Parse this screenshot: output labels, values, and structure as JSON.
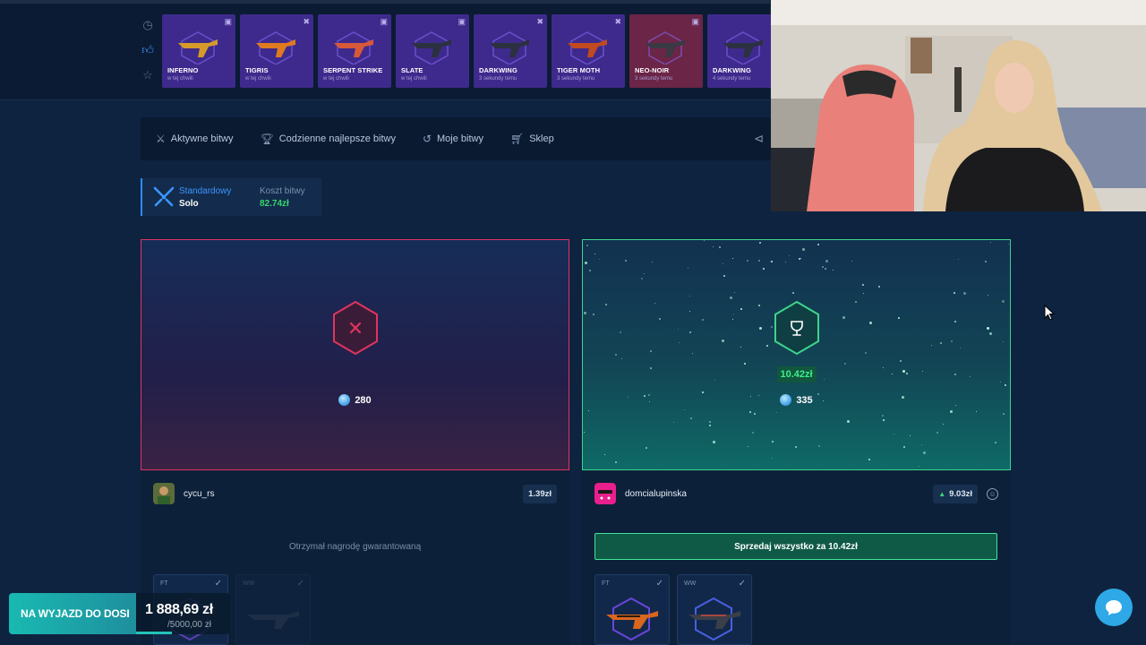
{
  "side_icons": [
    "clock-icon",
    "thumbs-up-icon",
    "star-icon"
  ],
  "drops": [
    {
      "name": "INFERNO",
      "sub": "w tej chwili",
      "color": "#3e2a8c",
      "variant": "purple"
    },
    {
      "name": "TIGRIS",
      "sub": "w tej chwili",
      "color": "#3e2a8c",
      "variant": "purple"
    },
    {
      "name": "SERPENT STRIKE",
      "sub": "w tej chwili",
      "color": "#3e2a8c",
      "variant": "purple"
    },
    {
      "name": "SLATE",
      "sub": "w tej chwili",
      "color": "#3e2a8c",
      "variant": "purple"
    },
    {
      "name": "DARKWING",
      "sub": "3 sekundy temu",
      "color": "#3e2a8c",
      "variant": "purple"
    },
    {
      "name": "TIGER MOTH",
      "sub": "3 sekundy temu",
      "color": "#3e2a8c",
      "variant": "purple"
    },
    {
      "name": "NEO-NOIR",
      "sub": "3 sekundy temu",
      "color": "#6b2547",
      "variant": "pink"
    },
    {
      "name": "DARKWING",
      "sub": "4 sekundy temu",
      "color": "#3e2a8c",
      "variant": "purple"
    }
  ],
  "nav": {
    "items": [
      {
        "label": "Aktywne bitwy",
        "icon": "swords-icon"
      },
      {
        "label": "Codzienne najlepsze bitwy",
        "icon": "trophy-icon"
      },
      {
        "label": "Moje bitwy",
        "icon": "history-icon"
      },
      {
        "label": "Sklep",
        "icon": "basket-icon"
      }
    ],
    "share_icon": "share-icon"
  },
  "mode": {
    "type_label": "Standardowy",
    "type_value": "Solo",
    "cost_label": "Koszt bitwy",
    "cost_value": "82.74zł"
  },
  "left_player": {
    "status_icon": "x-icon",
    "coins": "280",
    "name": "cycu_rs",
    "amount": "1.39zł",
    "message": "Otrzymał nagrodę gwarantowaną",
    "items": [
      {
        "condition": "FT"
      },
      {
        "condition": "WW"
      }
    ]
  },
  "right_player": {
    "status_icon": "trophy-icon",
    "win_amount": "10.42zł",
    "coins": "335",
    "name": "domcialupinska",
    "amount": "9.03zł",
    "sell_button": "Sprzedaj wszystko za 10.42zł",
    "items": [
      {
        "condition": "FT"
      },
      {
        "condition": "WW"
      }
    ]
  },
  "promo": {
    "title": "NA WYJAZD DO DOSI",
    "current": "1 888,69 zł",
    "goal": "/5000,00 zł",
    "progress": 0.378
  },
  "colors": {
    "accent_blue": "#2f8cff",
    "win_green": "#3ed48c",
    "lose_red": "#e0345e",
    "promo_teal": "#19b9b1"
  }
}
